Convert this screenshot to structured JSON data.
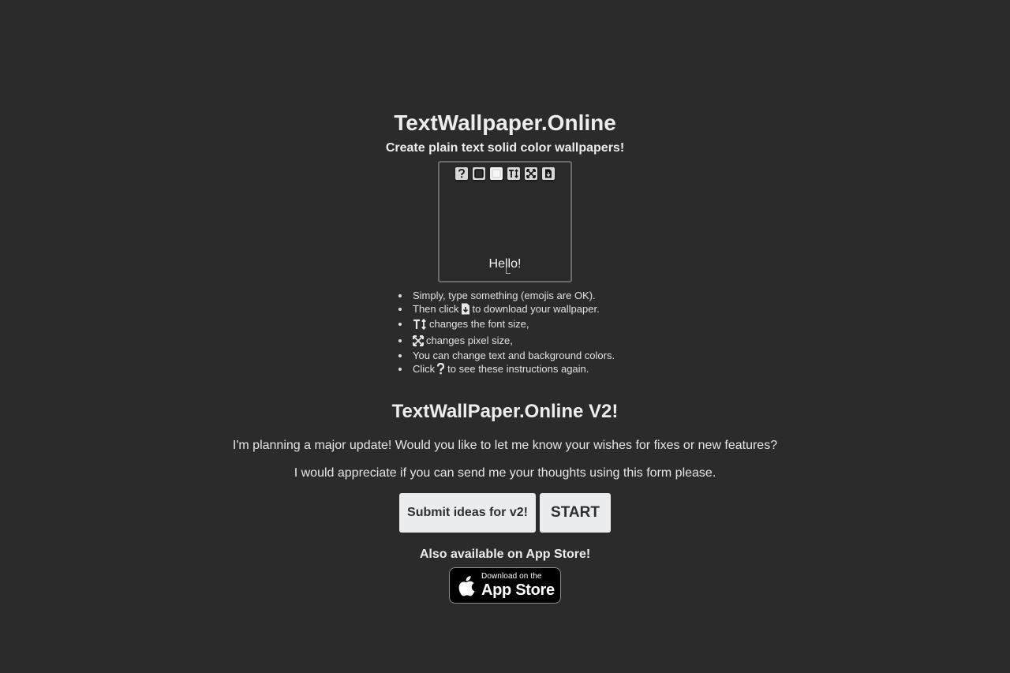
{
  "header": {
    "title": "TextWallpaper.Online",
    "subtitle": "Create plain text solid color wallpapers!"
  },
  "preview": {
    "toolbar": [
      {
        "name": "help-icon",
        "label": "?"
      },
      {
        "name": "background-color-icon",
        "label": ""
      },
      {
        "name": "text-color-icon",
        "label": ""
      },
      {
        "name": "font-size-icon",
        "label": ""
      },
      {
        "name": "pixel-size-icon",
        "label": ""
      },
      {
        "name": "download-icon",
        "label": ""
      }
    ],
    "text": "Hello!"
  },
  "instructions": {
    "item1": "Simply, type something (emojis are OK).",
    "item2_before": "Then click",
    "item2_after": "to download your wallpaper.",
    "item3": "changes the font size,",
    "item4": "changes pixel size,",
    "item5": "You can change text and background colors.",
    "item6_before": "Click",
    "item6_after": "to see these instructions again."
  },
  "v2": {
    "title": "TextWallPaper.Online V2!",
    "paragraph1": "I'm planning a major update! Would you like to let me know your wishes for fixes or new features?",
    "paragraph2": "I would appreciate if you can send me your thoughts using this form please.",
    "submit_label": "Submit ideas for v2!",
    "start_label": "START"
  },
  "appstore": {
    "heading": "Also available on App Store!",
    "badge_small": "Download on the",
    "badge_large": "App Store"
  },
  "colors": {
    "background": "#2b2b2b",
    "text": "#ededed",
    "button": "#e9edf0"
  }
}
